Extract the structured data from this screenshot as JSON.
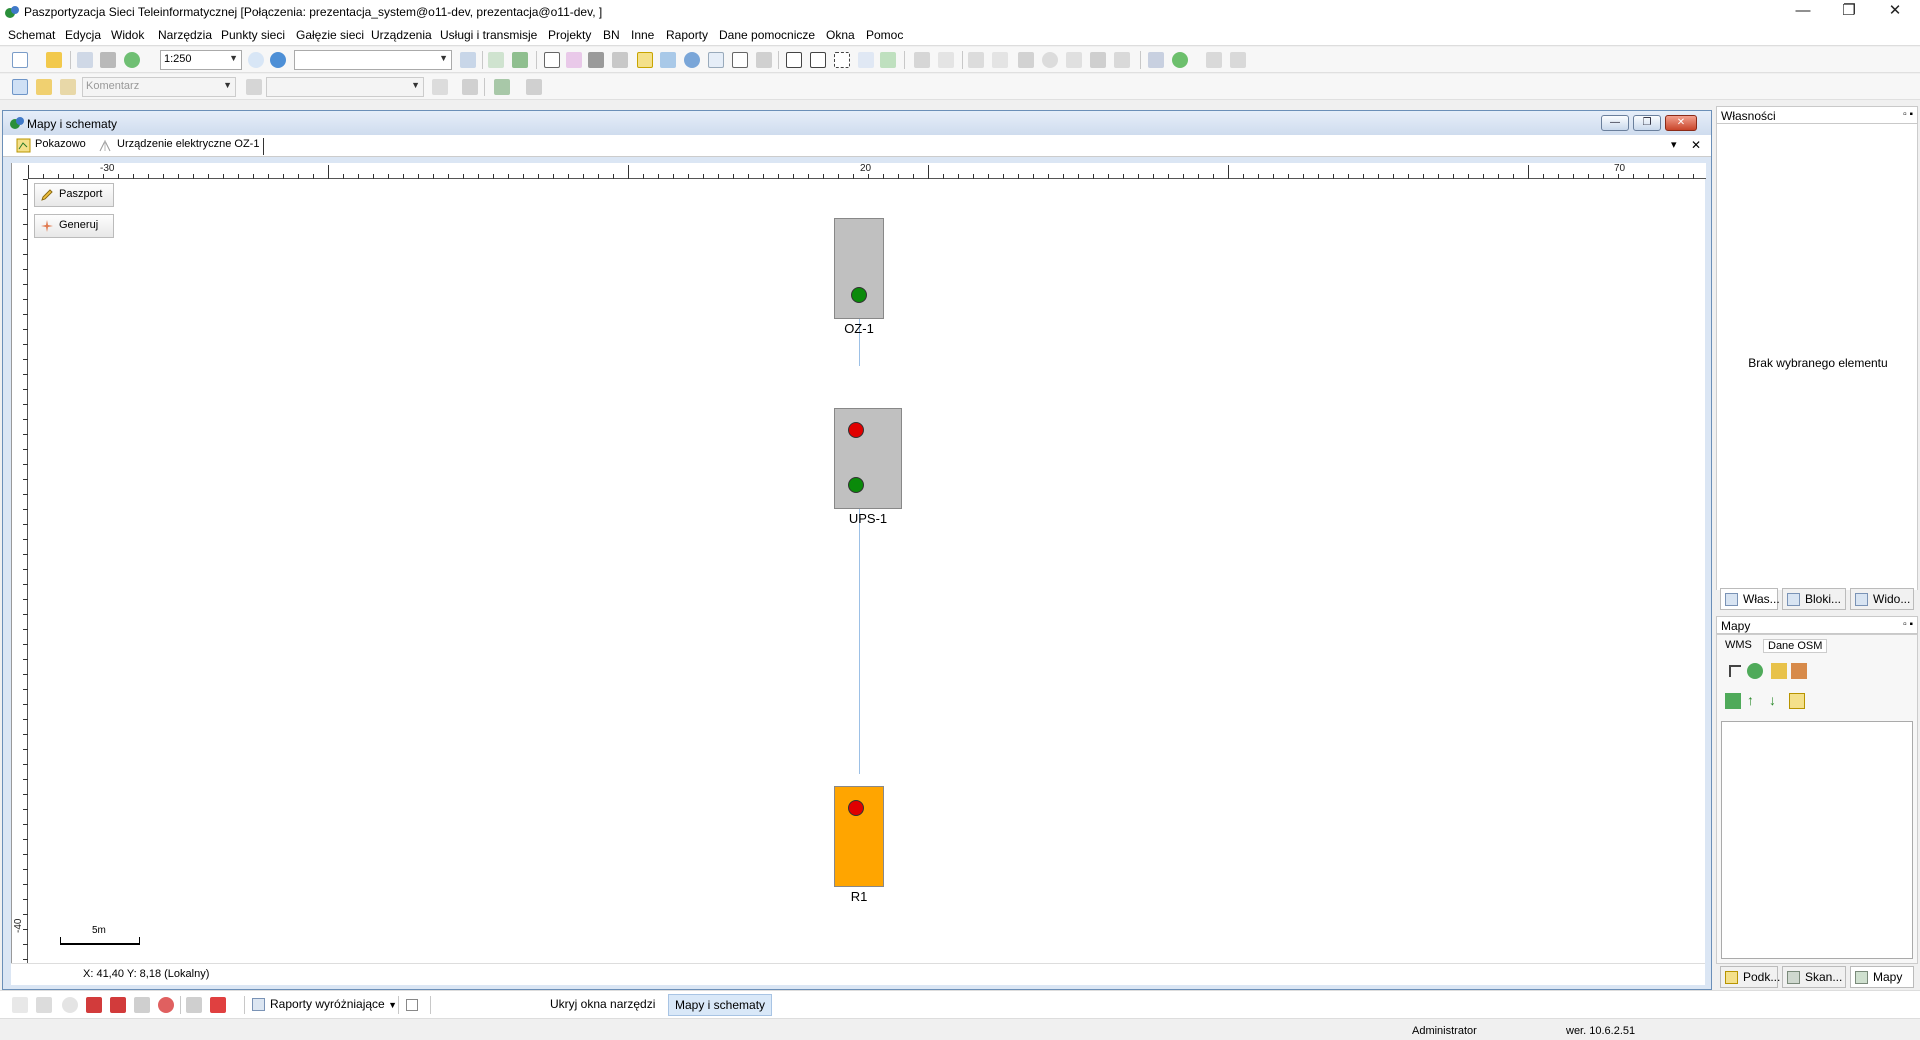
{
  "window": {
    "title": "Paszportyzacja Sieci Teleinformatycznej [Połączenia: prezentacja_system@o11-dev, prezentacja@o11-dev, ]",
    "controls": {
      "minimize": "—",
      "restore": "❐",
      "close": "✕"
    }
  },
  "menu": [
    "Schemat",
    "Edycja",
    "Widok",
    "Narzędzia",
    "Punkty sieci",
    "Gałęzie sieci",
    "Urządzenia",
    "Usługi i transmisje",
    "Projekty",
    "BN",
    "Inne",
    "Raporty",
    "Dane pomocnicze",
    "Okna",
    "Pomoc"
  ],
  "toolbar1": {
    "scale_value": "1:250",
    "search_value": ""
  },
  "toolbar2": {
    "comment_placeholder": "Komentarz",
    "second_combo_value": ""
  },
  "document": {
    "title": "Mapy i schematy",
    "tabs": [
      {
        "label": "Pokazowo"
      },
      {
        "label": "Urządzenie elektryczne OZ-1"
      }
    ],
    "tab_controls": {
      "dropdown": "▾",
      "close": "✕"
    },
    "mdi_controls": {
      "minimize": "—",
      "restore": "❐",
      "close": "✕"
    },
    "ruler": {
      "top_labels": [
        "-30",
        "20",
        "70"
      ],
      "left_labels": [
        "-40"
      ]
    },
    "side_buttons": [
      {
        "label": "Paszport"
      },
      {
        "label": "Generuj"
      }
    ],
    "scale_bar": "5m",
    "coords": "X: 41,40  Y: 8,18 (Lokalny)",
    "nodes": [
      {
        "label": "OZ-1",
        "fill": "#c0c0c0",
        "leds": [
          "#0a8a0a"
        ]
      },
      {
        "label": "UPS-1",
        "fill": "#c0c0c0",
        "leds": [
          "#e00000",
          "#0a8a0a"
        ]
      },
      {
        "label": "R1",
        "fill": "#ffa500",
        "leds": [
          "#e00000"
        ]
      }
    ]
  },
  "properties_panel": {
    "title": "Własności",
    "empty_text": "Brak wybranego elementu",
    "pins": "▫ ▪",
    "tabs": [
      {
        "label": "Włas..."
      },
      {
        "label": "Bloki..."
      },
      {
        "label": "Wido..."
      }
    ]
  },
  "maps_panel": {
    "title": "Mapy",
    "pins": "▫ ▪",
    "tabs": [
      {
        "label": "WMS"
      },
      {
        "label": "Dane OSM"
      }
    ],
    "bottom_tabs": [
      {
        "label": "Podk..."
      },
      {
        "label": "Skan..."
      },
      {
        "label": "Mapy"
      }
    ]
  },
  "statusbar": {
    "reports_label": "Raporty wyróżniające",
    "hide_tools_label": "Ukryj okna narzędzi",
    "maps_label": "Mapy i schematy"
  },
  "bottombar": {
    "user": "Administrator",
    "version": "wer. 10.6.2.51"
  },
  "colors": {
    "accent": "#3b6fb6",
    "link": "#9cc0e6"
  }
}
